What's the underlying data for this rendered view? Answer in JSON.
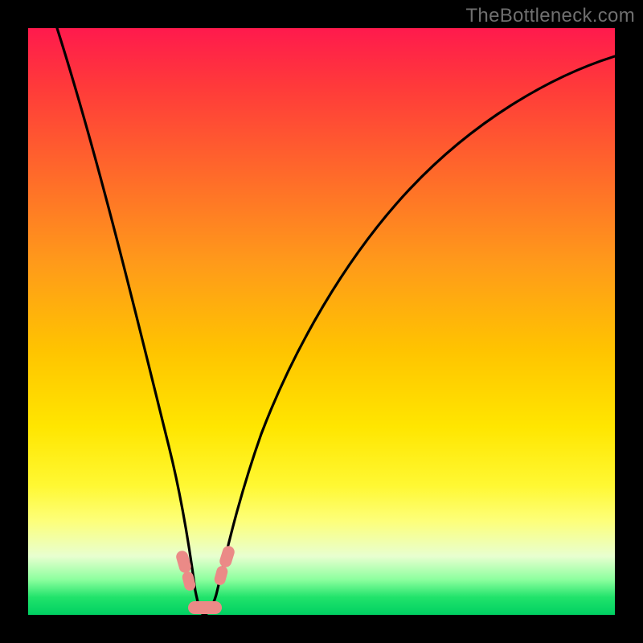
{
  "watermark": "TheBottleneck.com",
  "colors": {
    "frame": "#000000",
    "watermark": "#6f6f6f",
    "curve": "#000000",
    "blob": "#eb8a87"
  },
  "chart_data": {
    "type": "line",
    "title": "",
    "xlabel": "",
    "ylabel": "",
    "xlim": [
      0,
      100
    ],
    "ylim": [
      0,
      100
    ],
    "series": [
      {
        "name": "bottleneck-curve",
        "x": [
          5,
          10,
          15,
          18,
          21,
          24,
          26,
          27,
          28,
          29,
          30,
          31,
          32,
          34,
          37,
          42,
          50,
          60,
          72,
          85,
          100
        ],
        "values": [
          100,
          80,
          57,
          42,
          27,
          14,
          6,
          3,
          1,
          0,
          0,
          1,
          3,
          8,
          17,
          30,
          45,
          59,
          71,
          80,
          87
        ]
      }
    ],
    "markers": [
      {
        "name": "left-marker",
        "x_range": [
          25.5,
          27.0
        ],
        "y_range": [
          3,
          10
        ]
      },
      {
        "name": "right-marker",
        "x_range": [
          31.5,
          33.0
        ],
        "y_range": [
          3,
          10
        ]
      },
      {
        "name": "valley-marker",
        "x_range": [
          27.0,
          32.0
        ],
        "y_range": [
          0,
          3
        ]
      }
    ]
  }
}
